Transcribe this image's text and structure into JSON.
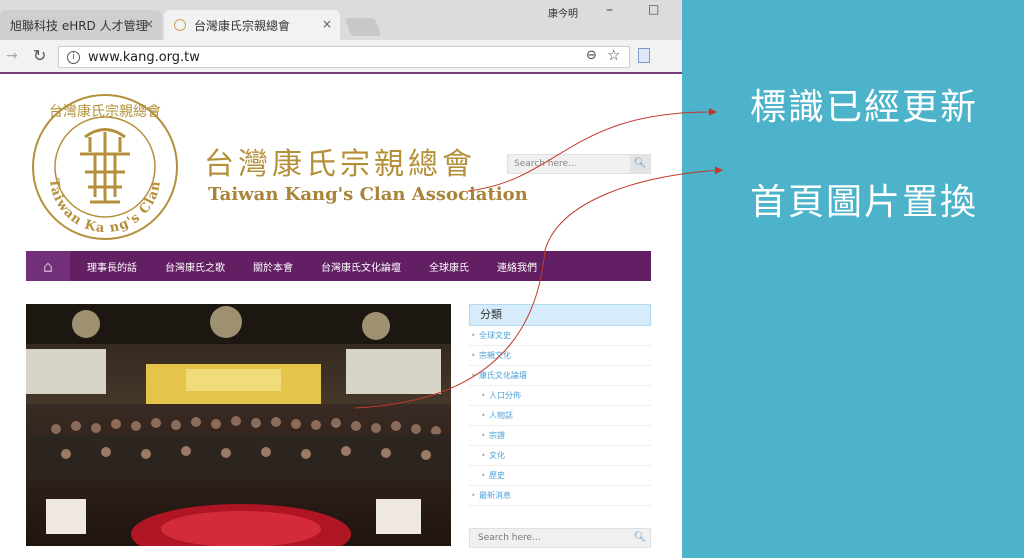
{
  "browser": {
    "tabs": [
      {
        "title": "旭聯科技 eHRD 人才管理",
        "close": "×"
      },
      {
        "title": "台灣康氏宗親總會",
        "close": "×"
      }
    ],
    "user_badge": "康今明",
    "minimize": "–",
    "maximize": "□",
    "address": "www.kang.org.tw"
  },
  "site": {
    "title_cn": "台灣康氏宗親總會",
    "title_en": "Taiwan Kang's  Clan Association",
    "seal_text": "Taiwan Ka ng's Clan Association",
    "search_top_placeholder": "Search here...",
    "nav": [
      "理事長的話",
      "台灣康氏之歌",
      "關於本會",
      "台灣康氏文化論壇",
      "全球康氏",
      "連絡我們"
    ],
    "sidebar": {
      "heading": "分類",
      "items": [
        "全球文史",
        "宗親文化",
        "康氏文化論壇",
        "人口分佈",
        "人物誌",
        "宗譜",
        "文化",
        "歷史",
        "最新消息"
      ]
    },
    "search_bottom_placeholder": "Search here..."
  },
  "annotations": {
    "note1": "標識已經更新",
    "note2": "首頁圖片置換"
  },
  "colors": {
    "nav_bg": "#631f64",
    "gold": "#b5903a",
    "panel_bg": "#4db3ca",
    "arrow": "#c0392b"
  }
}
